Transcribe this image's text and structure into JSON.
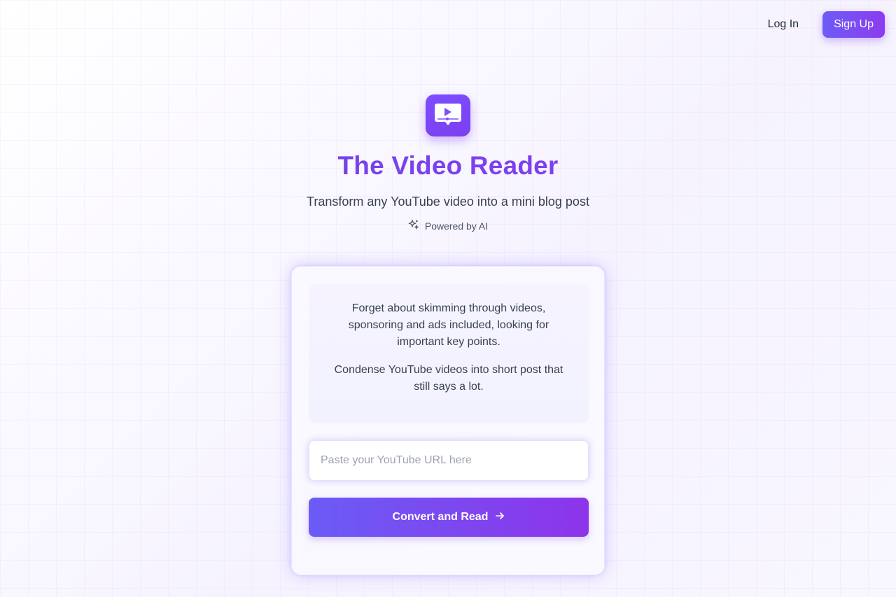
{
  "header": {
    "login_label": "Log In",
    "signup_label": "Sign Up"
  },
  "hero": {
    "logo_icon": "video-reader-logo-icon",
    "title": "The Video Reader",
    "subtitle": "Transform any YouTube video into a mini blog post",
    "powered_icon": "sparkles-icon",
    "powered_label": "Powered by AI"
  },
  "card": {
    "info_paragraph_1": "Forget about skimming through videos, sponsoring and ads included, looking for important key points.",
    "info_paragraph_2": "Condense YouTube videos into short post that still says a lot.",
    "url_input": {
      "placeholder": "Paste your YouTube URL here",
      "value": ""
    },
    "convert_label": "Convert and Read",
    "convert_icon": "arrow-right-icon"
  },
  "colors": {
    "accent_start": "#6b5cf6",
    "accent_end": "#8d34ea",
    "title_gradient_start": "#6b46e8",
    "title_gradient_end": "#8b3cf0"
  }
}
